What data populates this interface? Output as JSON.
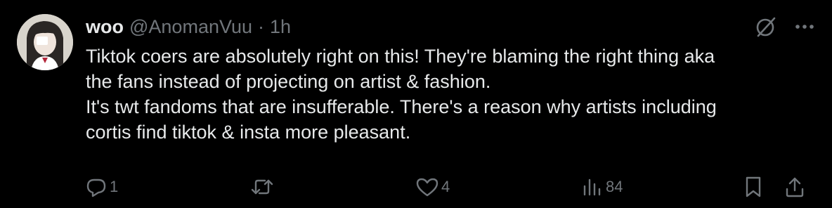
{
  "tweet": {
    "display_name": "woo",
    "handle": "@AnomanVuu",
    "separator": "·",
    "time": "1h",
    "body_lines": [
      "Tiktok coers are absolutely right on this! They're blaming the right thing aka",
      "the fans instead of projecting on artist & fashion.",
      "It's twt fandoms that are insufferable. There's a reason why artists including",
      "cortis find tiktok & insta more pleasant."
    ],
    "top_icons": [
      "grok-icon",
      "more-icon"
    ],
    "actions": {
      "reply": {
        "icon": "reply-icon",
        "count": "1"
      },
      "retweet": {
        "icon": "retweet-icon",
        "count": ""
      },
      "like": {
        "icon": "heart-icon",
        "count": "4"
      },
      "views": {
        "icon": "views-icon",
        "count": "84"
      },
      "bookmark": {
        "icon": "bookmark-icon"
      },
      "share": {
        "icon": "share-icon"
      }
    }
  },
  "colors": {
    "background": "#000000",
    "text_primary": "#e7e9ea",
    "text_secondary": "#71767b"
  }
}
